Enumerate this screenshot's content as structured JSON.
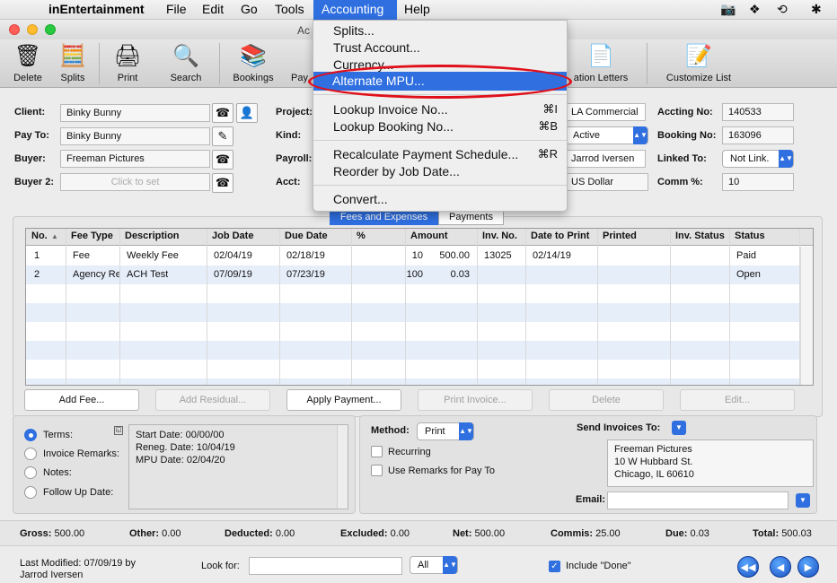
{
  "menubar": {
    "app": "inEntertainment",
    "items": [
      "File",
      "Edit",
      "Go",
      "Tools",
      "Accounting",
      "Help"
    ]
  },
  "window": {
    "title": "Ac"
  },
  "toolbar": {
    "items": [
      "Delete",
      "Splits",
      "Print",
      "Search",
      "Bookings",
      "Pay"
    ],
    "right_items": [
      "ation Letters",
      "Customize List"
    ]
  },
  "form": {
    "client_label": "Client:",
    "client": "Binky Bunny",
    "payto_label": "Pay To:",
    "payto": "Binky Bunny",
    "buyer_label": "Buyer:",
    "buyer": "Freeman Pictures",
    "buyer2_label": "Buyer 2:",
    "buyer2_placeholder": "Click to set",
    "project_label": "Project:",
    "kind_label": "Kind:",
    "payroll_label": "Payroll:",
    "acct_label": "Acct:",
    "r_field1": "LA Commercial",
    "r_status": "Active",
    "r_agent": "Jarrod Iversen",
    "r_currency": "US Dollar",
    "accting_label": "Accting No:",
    "accting": "140533",
    "booking_label": "Booking No:",
    "booking": "163096",
    "linked_label": "Linked To:",
    "linked": "Not Link.",
    "comm_label": "Comm %:",
    "comm": "10"
  },
  "tabs": [
    "Fees and Expenses",
    "Payments"
  ],
  "table": {
    "headers": [
      "No.",
      "Fee Type",
      "Description",
      "Job Date",
      "Due Date",
      "%",
      "Amount",
      "Inv. No.",
      "Date to Print",
      "Printed",
      "Inv. Status",
      "Status"
    ],
    "rows": [
      [
        "1",
        "Fee",
        "Weekly Fee",
        "02/04/19",
        "02/18/19",
        "10",
        "500.00",
        "13025",
        "02/14/19",
        "",
        "",
        "Paid"
      ],
      [
        "2",
        "Agency Re",
        "ACH Test",
        "07/09/19",
        "07/23/19",
        "100",
        "0.03",
        "",
        "",
        "",
        "",
        "Open"
      ]
    ]
  },
  "buttons": [
    "Add Fee...",
    "Add Residual...",
    "Apply Payment...",
    "Print Invoice...",
    "Delete",
    "Edit..."
  ],
  "radios": [
    "Terms:",
    "Invoice Remarks:",
    "Notes:",
    "Follow Up Date:"
  ],
  "terms_text": [
    "Start Date: 00/00/00",
    "Reneg. Date: 10/04/19",
    "MPU Date: 02/04/20"
  ],
  "method": {
    "label": "Method:",
    "value": "Print",
    "recurring": "Recurring",
    "use_remarks": "Use Remarks for Pay To"
  },
  "send": {
    "label": "Send Invoices To:",
    "address": [
      "Freeman Pictures",
      "10 W Hubbard St.",
      "Chicago, IL 60610"
    ],
    "email_label": "Email:"
  },
  "totals": [
    {
      "label": "Gross:",
      "value": "500.00"
    },
    {
      "label": "Other:",
      "value": "0.00"
    },
    {
      "label": "Deducted:",
      "value": "0.00"
    },
    {
      "label": "Excluded:",
      "value": "0.00"
    },
    {
      "label": "Net:",
      "value": "500.00"
    },
    {
      "label": "Commis:",
      "value": "25.00"
    },
    {
      "label": "Due:",
      "value": "0.03"
    },
    {
      "label": "Total:",
      "value": "500.03"
    }
  ],
  "footer": {
    "modified_line1": "Last Modified: 07/09/19 by",
    "modified_line2": "Jarrod Iversen",
    "lookfor_label": "Look for:",
    "filter": "All",
    "include_done": "Include \"Done\""
  },
  "dropdown": {
    "items": [
      "Splits...",
      "Trust Account...",
      "Currency...",
      "Alternate MPU...",
      "Lookup Invoice No...",
      "Lookup Booking No...",
      "Recalculate Payment Schedule...",
      "Reorder by Job Date...",
      "Convert..."
    ],
    "shortcuts": {
      "lookup_invoice": "⌘I",
      "lookup_booking": "⌘B",
      "recalc": "⌘R"
    }
  }
}
